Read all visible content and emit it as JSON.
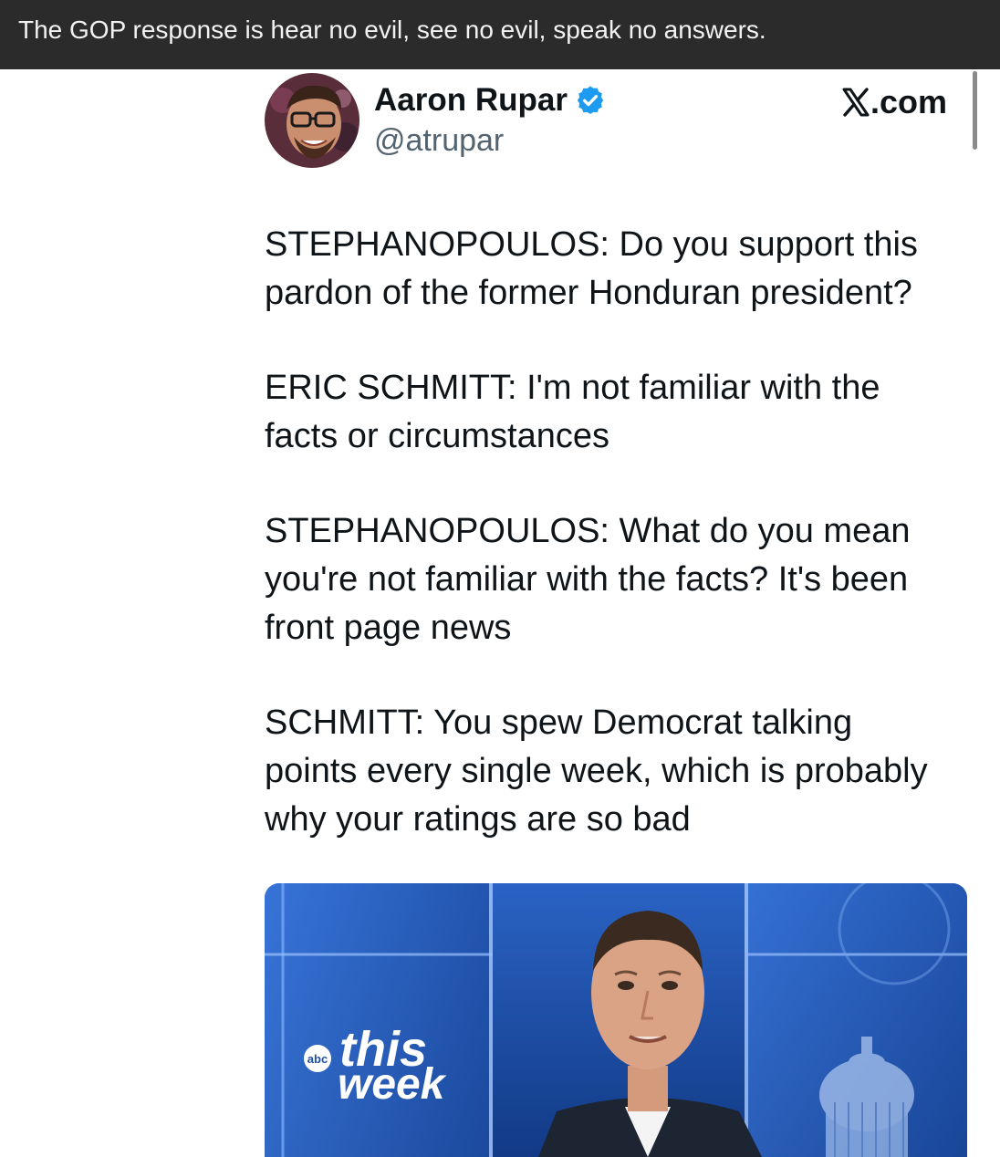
{
  "caption": {
    "text": "The GOP response is hear no evil, see no evil, speak no answers."
  },
  "tweet": {
    "author": {
      "name": "Aaron Rupar",
      "handle": "@atrupar",
      "verified_icon": "verified-badge-icon",
      "avatar_icon": "avatar-photo"
    },
    "source": {
      "icon": "x-logo-icon",
      "text": ".com"
    },
    "paragraphs": [
      "STEPHANOPOULOS: Do you support this\npardon of the former Honduran president?",
      "ERIC SCHMITT: I'm not familiar with the\nfacts or circumstances",
      "STEPHANOPOULOS: What do you mean\nyou're not familiar with the facts? It's been\nfront page news",
      "SCHMITT: You spew Democrat talking\npoints every single week, which is probably\nwhy your ratings are so bad"
    ],
    "media": {
      "logo_network": "abc",
      "logo_line1": "this",
      "logo_line2": "week"
    }
  },
  "colors": {
    "caption_bg": "#2b2b2b",
    "caption_text": "#f2f2f2",
    "verified_blue": "#1d9bf0",
    "handle_gray": "#536471",
    "text_primary": "#0f1419",
    "studio_blue": "#1f4fa8"
  }
}
